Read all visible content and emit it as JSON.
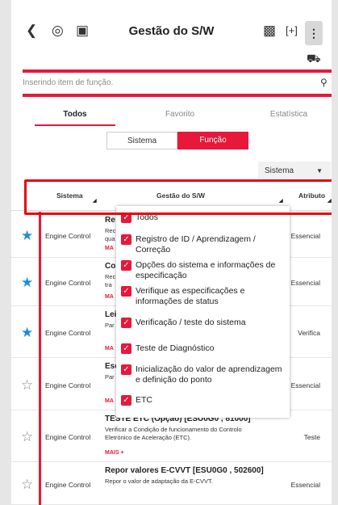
{
  "header": {
    "title": "Gestão do S/W",
    "back_icon": "chevron-left-icon",
    "kebab": "⋮"
  },
  "search": {
    "placeholder": "Inserindo item de função."
  },
  "tabs": [
    "Todos",
    "Favorito",
    "Estatística"
  ],
  "segment": {
    "option1": "Sistema",
    "option2": "Função"
  },
  "dropdown": {
    "value": "Sistema"
  },
  "columns": {
    "sistema": "Sistema",
    "gestao": "Gestão do S/W",
    "atributo": "Atributo"
  },
  "rows": [
    {
      "starred": true,
      "system": "Engine Control",
      "title": "Re",
      "desc": "Rec\nqua",
      "more": "MA",
      "attribute": "Essencial"
    },
    {
      "starred": true,
      "system": "Engine Control",
      "title": "Co",
      "desc": "Rec\ntra",
      "more": "MA",
      "attribute": "Essencial"
    },
    {
      "starred": true,
      "system": "Engine Control",
      "title": "Lei",
      "desc": "Par",
      "more": "MA",
      "attribute": "Verifica"
    },
    {
      "starred": false,
      "system": "Engine Control",
      "title": "Esc",
      "desc": "Par",
      "more": "MA",
      "attribute": "Essencial"
    },
    {
      "starred": false,
      "system": "Engine Control",
      "title": "TESTE ETC (Opção) [ESU0G0 , 81000]",
      "desc": "Verificar a Condição de funcionamento do Controlo\nEletrónico de Aceleração (ETC).",
      "more": "MAIS +",
      "attribute": "Teste"
    },
    {
      "starred": false,
      "system": "Engine Control",
      "title": "Repor valores E-CVVT [ESU0G0 , 502600]",
      "desc": "Repor o valor de adaptação da E-CVVT.",
      "more": "",
      "attribute": "Essencial"
    }
  ],
  "filter_options": [
    {
      "label": "Todos",
      "checked": true
    },
    {
      "label": "Registro de ID / Aprendizagem / Correção",
      "checked": true
    },
    {
      "label": "Opções do sistema e informações de especificação",
      "checked": true
    },
    {
      "label": "Verifique as especificações e informações de status",
      "checked": true
    },
    {
      "label": "Verificação / teste do sistema",
      "checked": true
    },
    {
      "label": "Teste de Diagnóstico",
      "checked": true
    },
    {
      "label": "Inicialização do valor de aprendizagem e definição do ponto",
      "checked": true
    },
    {
      "label": "ETC",
      "checked": true
    }
  ],
  "colors": {
    "accent": "#e8183a",
    "star": "#1e8fd6"
  }
}
